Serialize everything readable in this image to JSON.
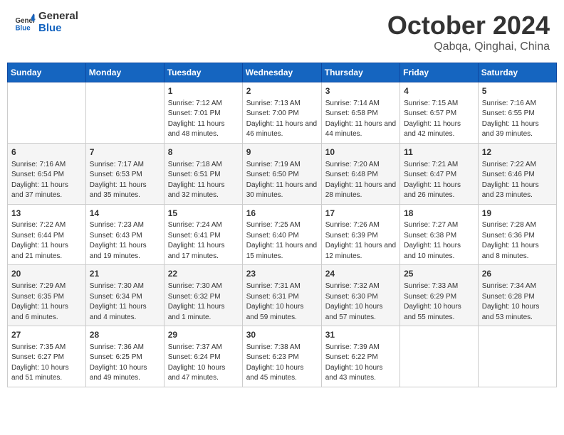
{
  "logo": {
    "line1": "General",
    "line2": "Blue"
  },
  "title": "October 2024",
  "location": "Qabqa, Qinghai, China",
  "days_of_week": [
    "Sunday",
    "Monday",
    "Tuesday",
    "Wednesday",
    "Thursday",
    "Friday",
    "Saturday"
  ],
  "weeks": [
    [
      {
        "day": "",
        "info": ""
      },
      {
        "day": "",
        "info": ""
      },
      {
        "day": "1",
        "info": "Sunrise: 7:12 AM\nSunset: 7:01 PM\nDaylight: 11 hours and 48 minutes."
      },
      {
        "day": "2",
        "info": "Sunrise: 7:13 AM\nSunset: 7:00 PM\nDaylight: 11 hours and 46 minutes."
      },
      {
        "day": "3",
        "info": "Sunrise: 7:14 AM\nSunset: 6:58 PM\nDaylight: 11 hours and 44 minutes."
      },
      {
        "day": "4",
        "info": "Sunrise: 7:15 AM\nSunset: 6:57 PM\nDaylight: 11 hours and 42 minutes."
      },
      {
        "day": "5",
        "info": "Sunrise: 7:16 AM\nSunset: 6:55 PM\nDaylight: 11 hours and 39 minutes."
      }
    ],
    [
      {
        "day": "6",
        "info": "Sunrise: 7:16 AM\nSunset: 6:54 PM\nDaylight: 11 hours and 37 minutes."
      },
      {
        "day": "7",
        "info": "Sunrise: 7:17 AM\nSunset: 6:53 PM\nDaylight: 11 hours and 35 minutes."
      },
      {
        "day": "8",
        "info": "Sunrise: 7:18 AM\nSunset: 6:51 PM\nDaylight: 11 hours and 32 minutes."
      },
      {
        "day": "9",
        "info": "Sunrise: 7:19 AM\nSunset: 6:50 PM\nDaylight: 11 hours and 30 minutes."
      },
      {
        "day": "10",
        "info": "Sunrise: 7:20 AM\nSunset: 6:48 PM\nDaylight: 11 hours and 28 minutes."
      },
      {
        "day": "11",
        "info": "Sunrise: 7:21 AM\nSunset: 6:47 PM\nDaylight: 11 hours and 26 minutes."
      },
      {
        "day": "12",
        "info": "Sunrise: 7:22 AM\nSunset: 6:46 PM\nDaylight: 11 hours and 23 minutes."
      }
    ],
    [
      {
        "day": "13",
        "info": "Sunrise: 7:22 AM\nSunset: 6:44 PM\nDaylight: 11 hours and 21 minutes."
      },
      {
        "day": "14",
        "info": "Sunrise: 7:23 AM\nSunset: 6:43 PM\nDaylight: 11 hours and 19 minutes."
      },
      {
        "day": "15",
        "info": "Sunrise: 7:24 AM\nSunset: 6:41 PM\nDaylight: 11 hours and 17 minutes."
      },
      {
        "day": "16",
        "info": "Sunrise: 7:25 AM\nSunset: 6:40 PM\nDaylight: 11 hours and 15 minutes."
      },
      {
        "day": "17",
        "info": "Sunrise: 7:26 AM\nSunset: 6:39 PM\nDaylight: 11 hours and 12 minutes."
      },
      {
        "day": "18",
        "info": "Sunrise: 7:27 AM\nSunset: 6:38 PM\nDaylight: 11 hours and 10 minutes."
      },
      {
        "day": "19",
        "info": "Sunrise: 7:28 AM\nSunset: 6:36 PM\nDaylight: 11 hours and 8 minutes."
      }
    ],
    [
      {
        "day": "20",
        "info": "Sunrise: 7:29 AM\nSunset: 6:35 PM\nDaylight: 11 hours and 6 minutes."
      },
      {
        "day": "21",
        "info": "Sunrise: 7:30 AM\nSunset: 6:34 PM\nDaylight: 11 hours and 4 minutes."
      },
      {
        "day": "22",
        "info": "Sunrise: 7:30 AM\nSunset: 6:32 PM\nDaylight: 11 hours and 1 minute."
      },
      {
        "day": "23",
        "info": "Sunrise: 7:31 AM\nSunset: 6:31 PM\nDaylight: 10 hours and 59 minutes."
      },
      {
        "day": "24",
        "info": "Sunrise: 7:32 AM\nSunset: 6:30 PM\nDaylight: 10 hours and 57 minutes."
      },
      {
        "day": "25",
        "info": "Sunrise: 7:33 AM\nSunset: 6:29 PM\nDaylight: 10 hours and 55 minutes."
      },
      {
        "day": "26",
        "info": "Sunrise: 7:34 AM\nSunset: 6:28 PM\nDaylight: 10 hours and 53 minutes."
      }
    ],
    [
      {
        "day": "27",
        "info": "Sunrise: 7:35 AM\nSunset: 6:27 PM\nDaylight: 10 hours and 51 minutes."
      },
      {
        "day": "28",
        "info": "Sunrise: 7:36 AM\nSunset: 6:25 PM\nDaylight: 10 hours and 49 minutes."
      },
      {
        "day": "29",
        "info": "Sunrise: 7:37 AM\nSunset: 6:24 PM\nDaylight: 10 hours and 47 minutes."
      },
      {
        "day": "30",
        "info": "Sunrise: 7:38 AM\nSunset: 6:23 PM\nDaylight: 10 hours and 45 minutes."
      },
      {
        "day": "31",
        "info": "Sunrise: 7:39 AM\nSunset: 6:22 PM\nDaylight: 10 hours and 43 minutes."
      },
      {
        "day": "",
        "info": ""
      },
      {
        "day": "",
        "info": ""
      }
    ]
  ]
}
